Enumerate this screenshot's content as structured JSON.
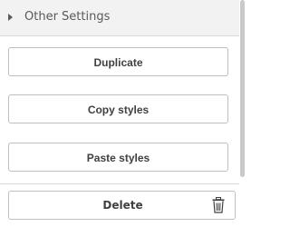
{
  "section": {
    "title": "Other Settings",
    "expanded": false
  },
  "buttons": {
    "duplicate": "Duplicate",
    "copy_styles": "Copy styles",
    "paste_styles": "Paste styles",
    "delete": "Delete"
  },
  "icons": {
    "section_toggle": "caret-right-icon",
    "delete": "trash-icon"
  },
  "colors": {
    "header_bg": "#f2f2f2",
    "border": "#bfbfbf",
    "text": "#404040",
    "muted_text": "#595959"
  }
}
